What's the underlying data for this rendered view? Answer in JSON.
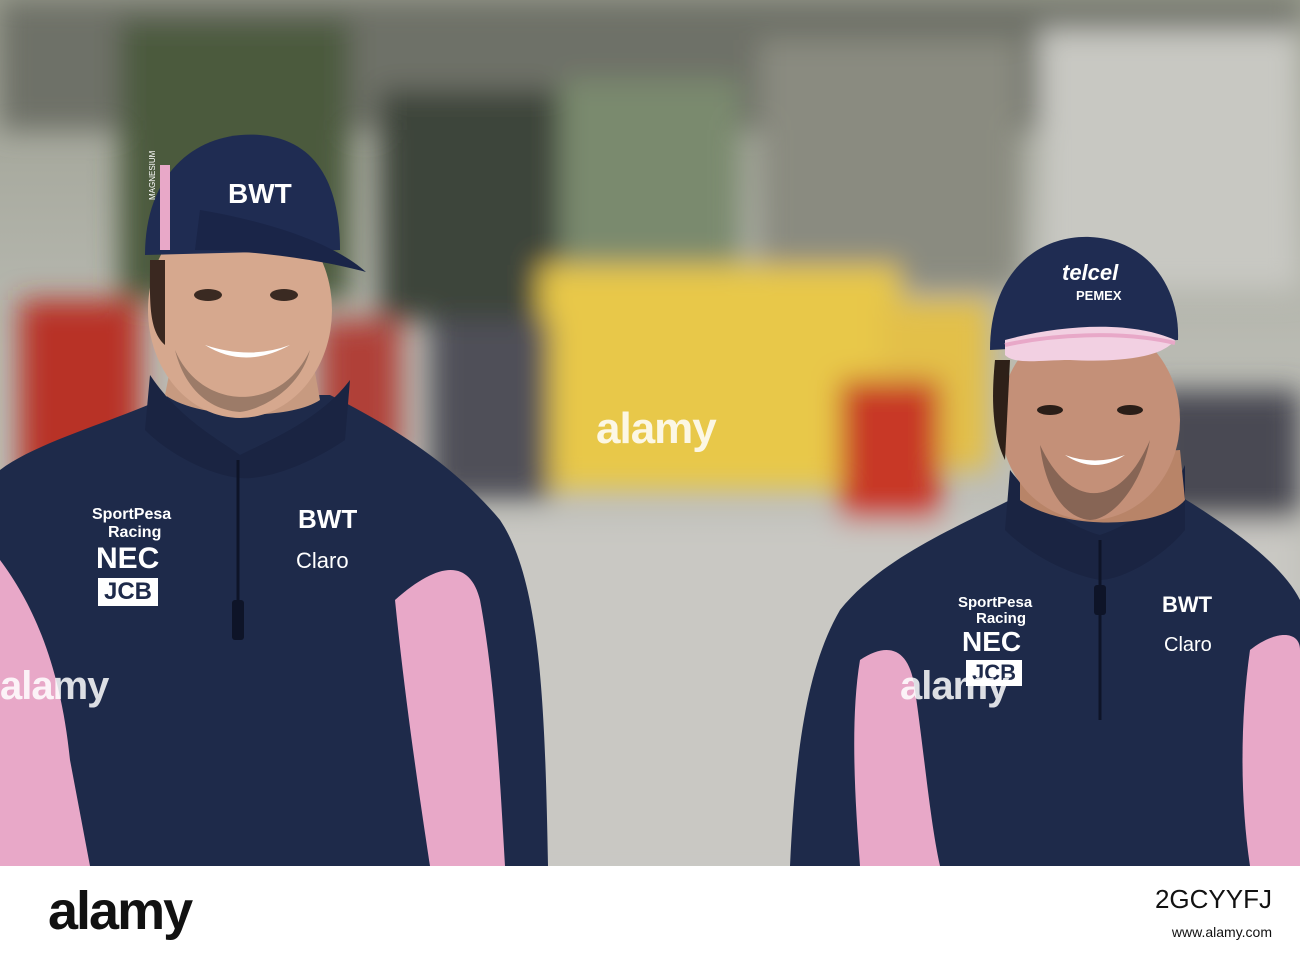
{
  "watermark": {
    "text": "alamy"
  },
  "footer": {
    "logo_text": "alamy",
    "image_id": "2GCYYFJ",
    "meta_text": "www.alamy.com"
  },
  "left_driver": {
    "cap_logo": "BWT",
    "cap_side": "MAGNESIUM",
    "chest_sponsors": [
      "SportPesa",
      "Racing",
      "NEC",
      "JCB"
    ],
    "chest_right": [
      "BWT",
      "Claro"
    ]
  },
  "right_driver": {
    "cap_logo": "telcel",
    "cap_sub": "PEMEX",
    "chest_sponsors": [
      "SportPesa",
      "Racing",
      "NEC",
      "JCB"
    ],
    "chest_right": [
      "BWT",
      "Claro"
    ]
  },
  "colors": {
    "navy": "#1e2a4a",
    "pink": "#e8a8c8",
    "yellow": "#e8c84a",
    "red": "#b83028"
  }
}
